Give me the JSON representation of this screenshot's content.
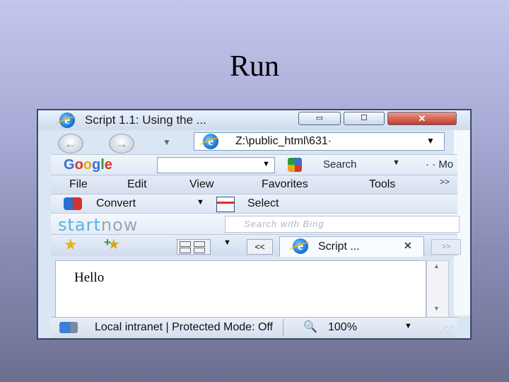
{
  "slide": {
    "title": "Run"
  },
  "window": {
    "title": "Script 1.1: Using the ...",
    "minimize": "▭",
    "maximize": "☐",
    "close": "✕"
  },
  "nav": {
    "back": "←",
    "forward": "→",
    "history_dropdown": "▼",
    "address": "Z:\\public_html\\631·",
    "address_dropdown": "▼"
  },
  "google_toolbar": {
    "logo": [
      "G",
      "o",
      "o",
      "g",
      "l",
      "e"
    ],
    "search_value": "",
    "search_label": "Search",
    "more_label": "· · Mo"
  },
  "menu": {
    "items": [
      "File",
      "Edit",
      "View",
      "Favorites",
      "Tools"
    ],
    "overflow": ">>"
  },
  "convert_toolbar": {
    "convert_label": "Convert",
    "select_label": "Select"
  },
  "startnow": {
    "logo_part1": "start",
    "logo_part2": "now",
    "search_placeholder": "Search with Bing"
  },
  "tabs": {
    "list_label": "<<",
    "active_label": "Script ...",
    "close": "✕",
    "new_tab": ">>"
  },
  "content": {
    "text": "Hello"
  },
  "status": {
    "zone": "Local intranet | Protected Mode: Off",
    "zoom": "100%",
    "zoom_dropdown": "▼"
  },
  "colors": {
    "slide_background_top": "#c4c6ec",
    "slide_background_bottom": "#6d6f91",
    "window_chrome": "#dbe6f4",
    "close_button": "#c4382a"
  },
  "icons": [
    "ie-logo-icon",
    "back-arrow-icon",
    "forward-arrow-icon",
    "google-search-icon",
    "convert-pdf-icon",
    "select-icon",
    "favorites-star-icon",
    "add-favorites-icon",
    "quick-tabs-icon",
    "intranet-icon",
    "zoom-icon"
  ]
}
